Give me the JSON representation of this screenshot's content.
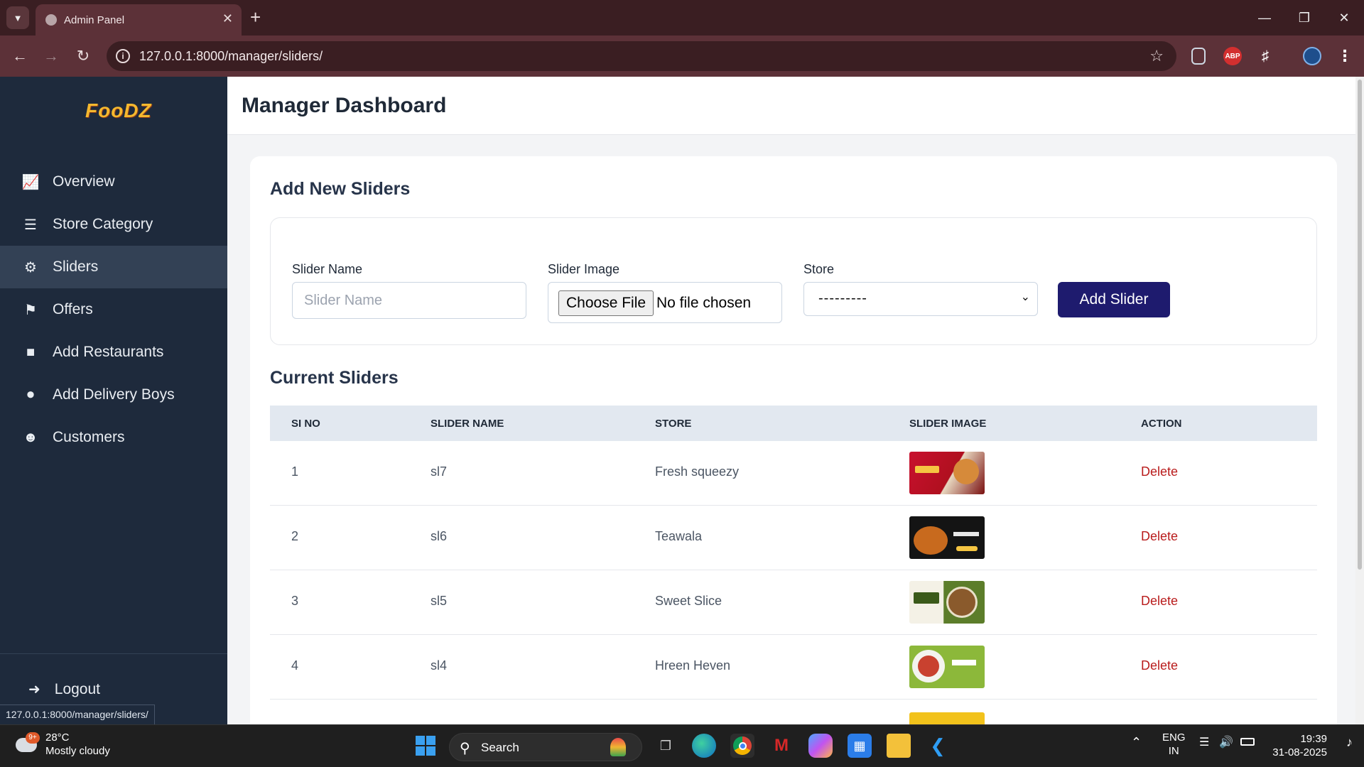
{
  "browser": {
    "tab_title": "Admin Panel",
    "url": "127.0.0.1:8000/manager/sliders/",
    "status_url": "127.0.0.1:8000/manager/sliders/",
    "ext_abp": "ABP"
  },
  "sidebar": {
    "logo": "FooDZ",
    "items": [
      {
        "label": "Overview",
        "icon": "chart-line-icon"
      },
      {
        "label": "Store Category",
        "icon": "list-icon"
      },
      {
        "label": "Sliders",
        "icon": "sliders-icon"
      },
      {
        "label": "Offers",
        "icon": "tag-icon"
      },
      {
        "label": "Add Restaurants",
        "icon": "store-icon"
      },
      {
        "label": "Add Delivery Boys",
        "icon": "motorcycle-icon"
      },
      {
        "label": "Customers",
        "icon": "users-icon"
      }
    ],
    "logout": "Logout"
  },
  "header": {
    "title": "Manager Dashboard"
  },
  "form": {
    "heading": "Add New Sliders",
    "name_label": "Slider Name",
    "name_placeholder": "Slider Name",
    "image_label": "Slider Image",
    "file_button": "Choose File",
    "file_status": "No file chosen",
    "store_label": "Store",
    "store_value": "---------",
    "submit": "Add Slider"
  },
  "table": {
    "heading": "Current Sliders",
    "columns": [
      "SI NO",
      "SLIDER NAME",
      "STORE",
      "SLIDER IMAGE",
      "ACTION"
    ],
    "rows": [
      {
        "no": "1",
        "name": "sl7",
        "store": "Fresh squeezy",
        "action": "Delete"
      },
      {
        "no": "2",
        "name": "sl6",
        "store": "Teawala",
        "action": "Delete"
      },
      {
        "no": "3",
        "name": "sl5",
        "store": "Sweet Slice",
        "action": "Delete"
      },
      {
        "no": "4",
        "name": "sl4",
        "store": "Hreen Heven",
        "action": "Delete"
      }
    ]
  },
  "taskbar": {
    "weather_temp": "28°C",
    "weather_desc": "Mostly cloudy",
    "weather_badge": "9+",
    "search": "Search",
    "lang1": "ENG",
    "lang2": "IN",
    "time": "19:39",
    "date": "31-08-2025"
  },
  "colors": {
    "sidebar_bg": "#1e2a3c",
    "active_bg": "#334155",
    "primary_button": "#1e1b6e",
    "delete_text": "#b91c1c"
  }
}
